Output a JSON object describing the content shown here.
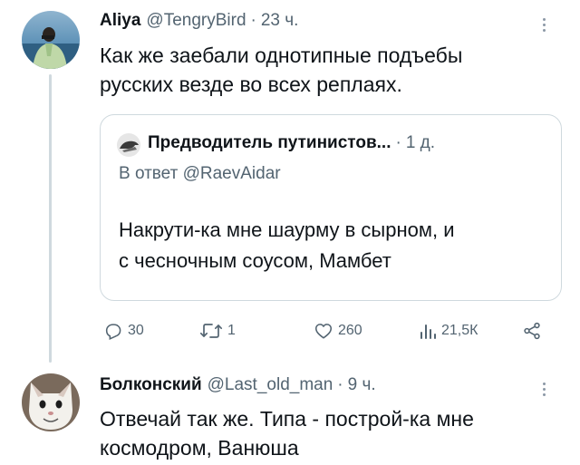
{
  "tweets": [
    {
      "name": "Aliya",
      "handle": "@TengryBird",
      "dot": "·",
      "time": "23 ч.",
      "lines": [
        "Как же заебали однотипные подъебы",
        "русских везде во всех реплаях."
      ],
      "quote": {
        "name": "Предводитель путинистов...",
        "dot": "·",
        "time": "1 д.",
        "reply_prefix": "В ответ",
        "reply_handle": "@RaevAidar",
        "lines": [
          "Накрути-ка мне шаурму в сырном, и",
          "с чесночным соусом, Мамбет"
        ]
      },
      "actions": {
        "replies": "30",
        "retweets": "1",
        "likes": "260",
        "views": "21,5К"
      }
    },
    {
      "name": "Болконский",
      "handle": "@Last_old_man",
      "dot": "·",
      "time": "9 ч.",
      "lines": [
        "Отвечай так же. Типа - построй-ка мне",
        "космодром, Ванюша"
      ]
    }
  ],
  "icons": {
    "reply": "reply-icon",
    "retweet": "retweet-icon",
    "like": "heart-icon",
    "views": "views-icon",
    "share": "share-icon",
    "more": "more-icon"
  },
  "colors": {
    "text": "#0f1419",
    "muted": "#536471",
    "border": "#cfd9de"
  }
}
